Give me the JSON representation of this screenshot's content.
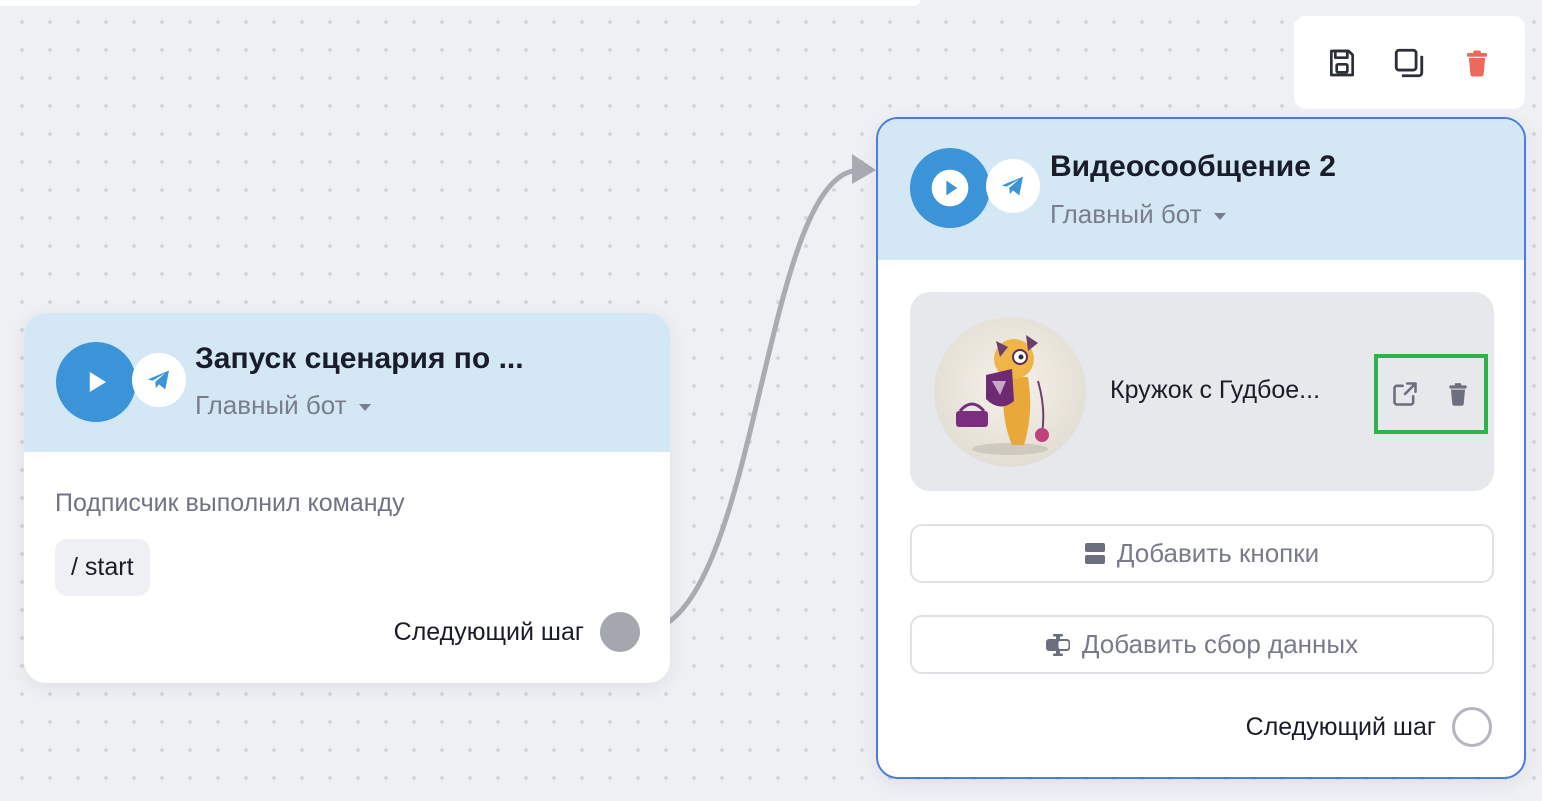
{
  "toolbar": {
    "save_icon": "save-icon",
    "copy_icon": "copy-icon",
    "delete_icon": "trash-icon",
    "delete_color": "#ec6a5a"
  },
  "start_node": {
    "title": "Запуск сценария по ...",
    "bot": "Главный бот",
    "trigger_description": "Подписчик выполнил команду",
    "command": "/ start",
    "next_step": "Следующий шаг"
  },
  "video_node": {
    "title": "Видеосообщение 2",
    "bot": "Главный бот",
    "media": {
      "name": "Кружок с Гудбое...",
      "open_icon": "external-link-icon",
      "delete_icon": "trash-icon"
    },
    "add_buttons_label": "Добавить кнопки",
    "add_data_label": "Добавить сбор данных",
    "next_step": "Следующий шаг"
  },
  "colors": {
    "header_bg": "#d3e7f5",
    "play_blue": "#3b94d8",
    "selection_border": "#4a7de0",
    "highlight_green": "#2cb34a"
  }
}
